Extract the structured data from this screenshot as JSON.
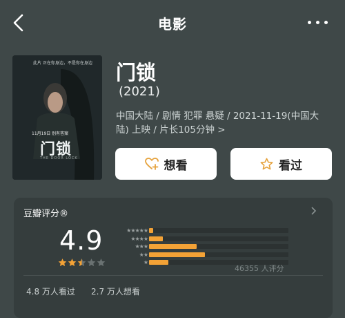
{
  "nav": {
    "title": "电影",
    "back_icon": "chevron-left-icon",
    "more_icon": "more-dots-icon"
  },
  "movie": {
    "title": "门锁",
    "year": "(2021)",
    "meta_line1": "中国大陆 / 剧情 犯罪 悬疑 / 2021-11-19(中国大",
    "meta_line2": "陆) 上映 / 片长105分钟 >",
    "poster": {
      "title": "门锁",
      "tagline": "此片 正在你身边，不是你在身边",
      "date_text": "11月19日 别有答案",
      "english": "THE DOOR LOCK"
    }
  },
  "actions": {
    "want_label": "想看",
    "seen_label": "看过"
  },
  "rating": {
    "header": "豆瓣评分®",
    "score": "4.9",
    "star_fill": 2.5,
    "distribution": [
      {
        "stars": "★★★★★",
        "fraction": 0.03
      },
      {
        "stars": "★★★★",
        "fraction": 0.1
      },
      {
        "stars": "★★★",
        "fraction": 0.34
      },
      {
        "stars": "★★",
        "fraction": 0.4
      },
      {
        "stars": "★",
        "fraction": 0.14
      }
    ],
    "count": "46355 人评分",
    "watched": "4.8 万人看过",
    "wishes": "2.7 万人想看"
  },
  "colors": {
    "background": "#3f4848",
    "accent": "#f3a236",
    "card": "#353d3d"
  }
}
